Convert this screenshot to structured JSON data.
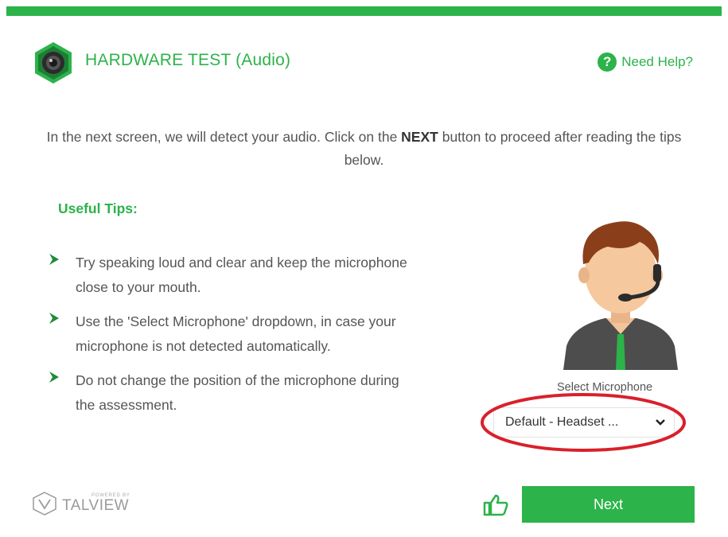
{
  "header": {
    "title": "HARDWARE TEST (Audio)",
    "help_label": "Need Help?",
    "help_symbol": "?"
  },
  "intro": {
    "text_before": "In the next screen, we will detect your audio. Click on the ",
    "emphasis": "NEXT",
    "text_after": " button to proceed after reading the tips below."
  },
  "tips": {
    "title": "Useful Tips:",
    "items": [
      "Try speaking loud and clear and keep the microphone close to your mouth.",
      "Use the 'Select Microphone' dropdown, in case your microphone is not detected automatically.",
      "Do not change the position of the microphone during the assessment."
    ]
  },
  "microphone": {
    "label": "Select Microphone",
    "selected": "Default - Headset ..."
  },
  "footer": {
    "powered_by": "POWERED BY",
    "brand": "TALVIEW",
    "next_label": "Next"
  },
  "colors": {
    "accent": "#2cb34a",
    "annotation": "#d9202a"
  },
  "icons": [
    "camera-icon",
    "help-icon",
    "chevron-right-icon",
    "chevron-down-icon",
    "thumbs-up-icon"
  ]
}
